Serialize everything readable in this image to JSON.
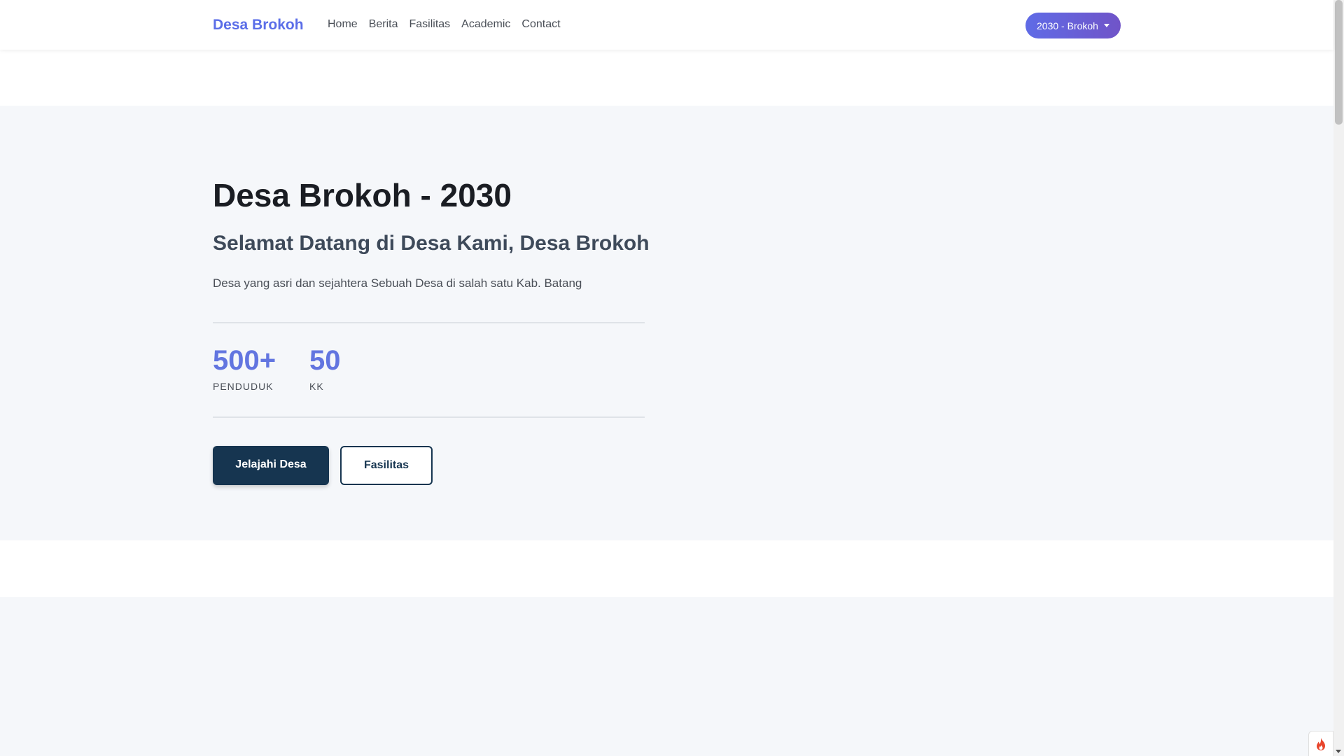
{
  "navbar": {
    "brand": "Desa Brokoh",
    "links": [
      {
        "label": "Home"
      },
      {
        "label": "Berita"
      },
      {
        "label": "Fasilitas"
      },
      {
        "label": "Academic"
      },
      {
        "label": "Contact"
      }
    ],
    "dropdown_label": "2030 - Brokoh"
  },
  "hero": {
    "title": "Desa Brokoh - 2030",
    "subtitle": "Selamat Datang di Desa Kami, Desa Brokoh",
    "description": "Desa yang asri dan sejahtera Sebuah Desa di salah satu Kab. Batang",
    "stats": [
      {
        "value": "500+",
        "label": "PENDUDUK"
      },
      {
        "value": "50",
        "label": "KK"
      }
    ],
    "primary_button": "Jelajahi Desa",
    "secondary_button": "Fasilitas"
  },
  "colors": {
    "brand": "#5b6ee8",
    "stat_value": "#6275e0",
    "primary_button": "#163550",
    "dropdown_gradient_start": "#5f6be6",
    "dropdown_gradient_end": "#7054c8",
    "section_background": "#f5f7fa"
  },
  "widget": {
    "icon": "flame-icon"
  }
}
